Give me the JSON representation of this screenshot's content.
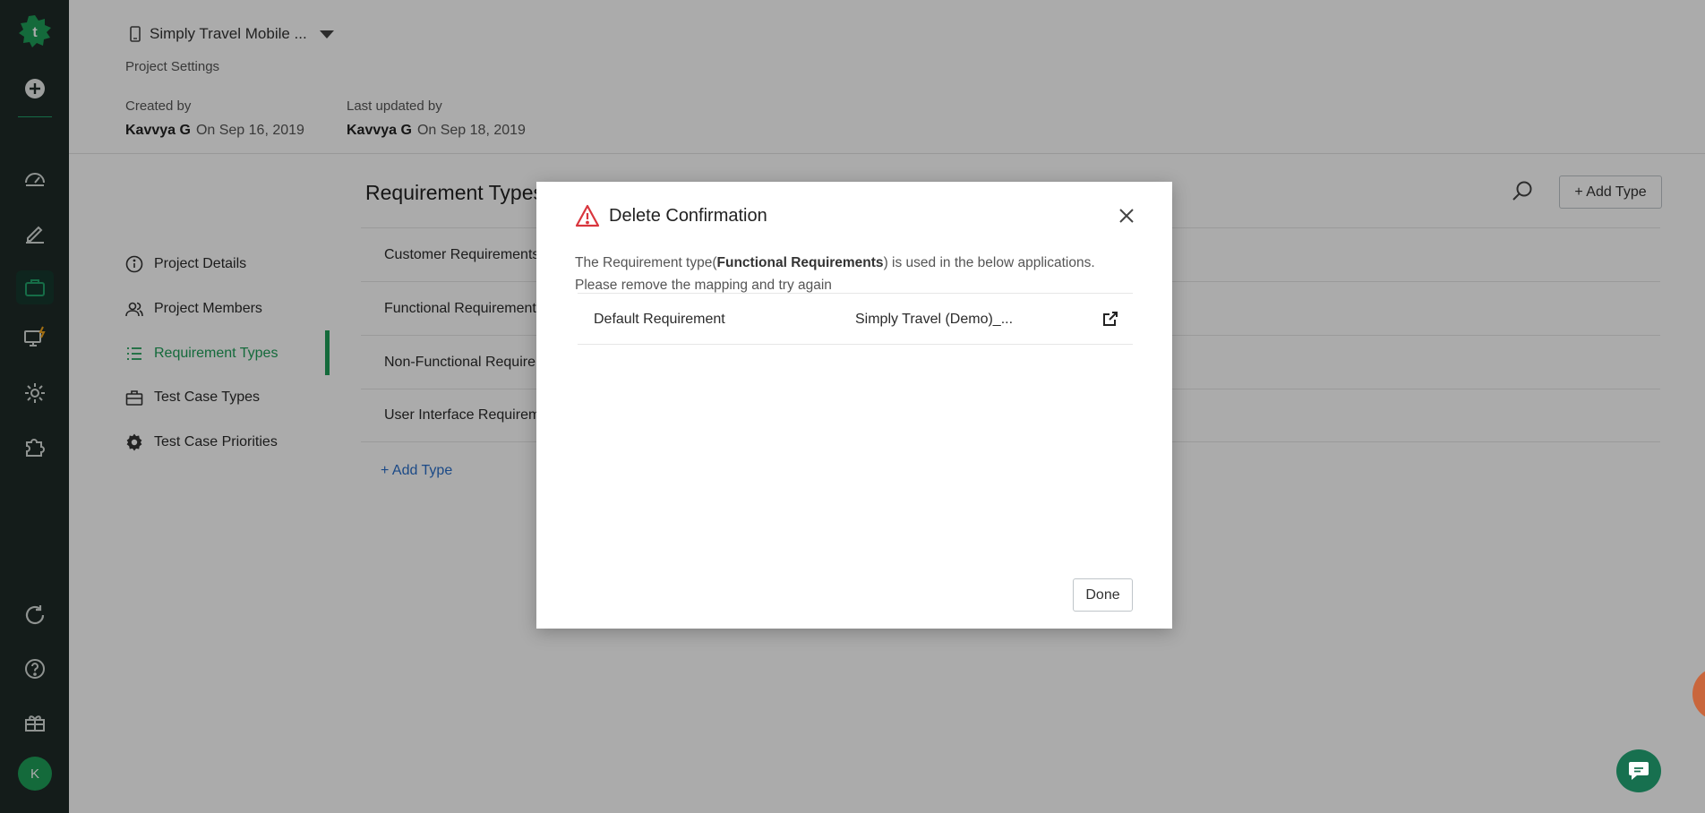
{
  "app": {
    "project_name": "Simply Travel Mobile ...",
    "breadcrumb": "Project Settings",
    "avatar_initial": "K",
    "brand_color": "#1e9e58"
  },
  "rail": {
    "icons": [
      "logo-icon",
      "add-icon",
      "dashboard-icon",
      "edit-icon",
      "briefcase-icon",
      "monitor-bolt-icon",
      "gear-icon",
      "puzzle-icon",
      "refresh-icon",
      "help-icon",
      "gift-icon"
    ]
  },
  "header": {
    "created_by_label": "Created by",
    "created_by_name": "Kavvya G",
    "created_on": "On Sep 16, 2019",
    "updated_by_label": "Last updated by",
    "updated_by_name": "Kavvya G",
    "updated_on": "On Sep 18, 2019"
  },
  "nav": {
    "items": [
      {
        "label": "Project Details",
        "icon": "info-icon"
      },
      {
        "label": "Project Members",
        "icon": "users-icon"
      },
      {
        "label": "Requirement Types",
        "icon": "list-icon",
        "active": true
      },
      {
        "label": "Test Case Types",
        "icon": "briefcase-icon"
      },
      {
        "label": "Test Case Priorities",
        "icon": "gear-icon"
      }
    ]
  },
  "content": {
    "title": "Requirement Types",
    "add_button": "+ Add Type",
    "rows": [
      "Customer Requirements",
      "Functional Requirements",
      "Non-Functional Requirements",
      "User Interface Requirements"
    ],
    "add_link": "+ Add Type"
  },
  "modal": {
    "title": "Delete Confirmation",
    "message_prefix": "The Requirement type(",
    "message_bold": "Functional Requirements",
    "message_suffix": ") is used in the below applications. Please remove the mapping and try again",
    "table": [
      {
        "requirement": "Default Requirement",
        "project": "Simply Travel (Demo)_..."
      }
    ],
    "done_label": "Done",
    "warning_color": "#d9363e"
  }
}
